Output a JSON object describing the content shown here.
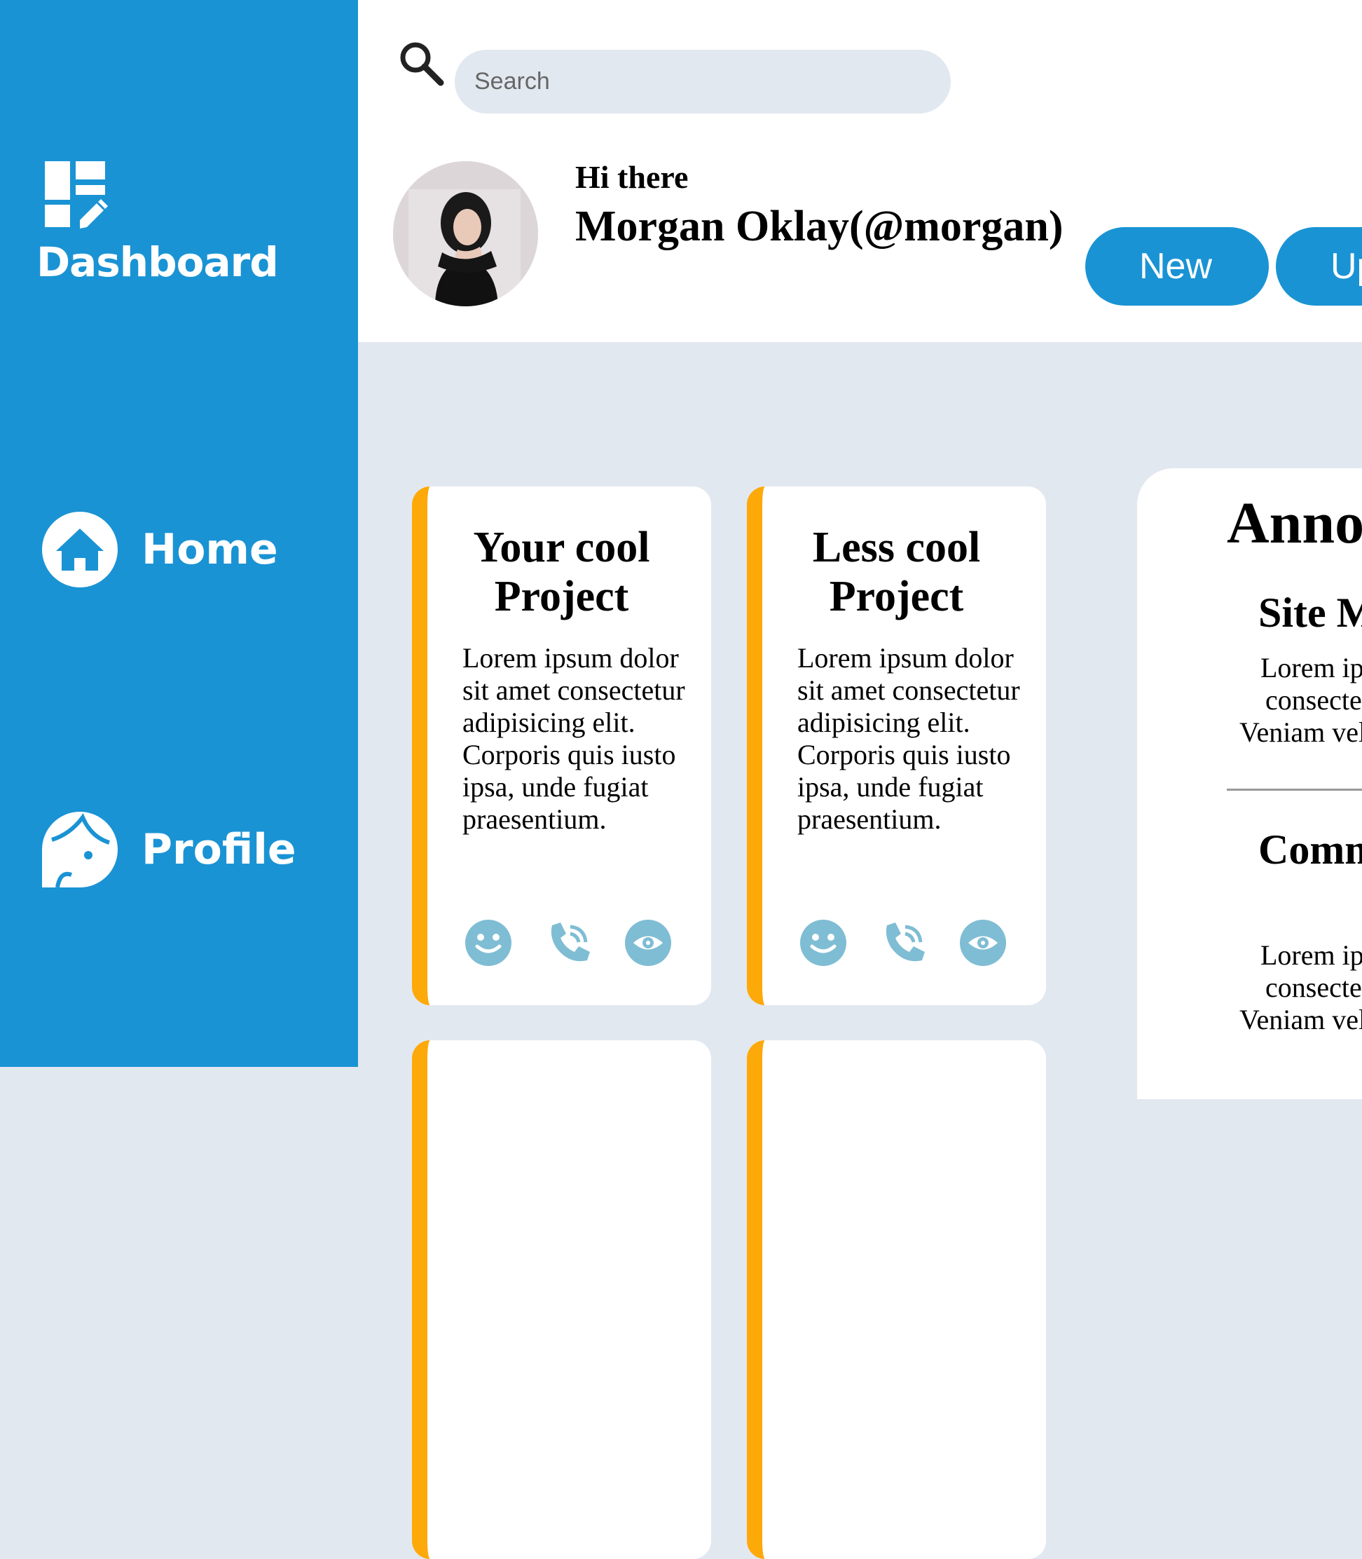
{
  "sidebar": {
    "brand": {
      "label": "Dashboard",
      "icon": "dashboard-edit-icon"
    },
    "items": [
      {
        "label": "Home",
        "icon": "home-icon"
      },
      {
        "label": "Profile",
        "icon": "profile-face-icon"
      }
    ],
    "color": "#1a93d4"
  },
  "header": {
    "search": {
      "placeholder": "Search",
      "value": ""
    },
    "greeting": "Hi there",
    "user_name": "Morgan Oklay(@morgan)",
    "buttons": {
      "new_label": "New",
      "upload_label": "Upload"
    }
  },
  "projects": [
    {
      "title": "Your cool Project",
      "body": "Lorem ipsum dolor sit amet consectetur adipisicing elit. Corporis quis iusto ipsa, unde fugiat praesentium.",
      "actions": [
        "smile-icon",
        "phone-icon",
        "eye-icon"
      ]
    },
    {
      "title": "Less cool Project",
      "body": "Lorem ipsum dolor sit amet consectetur adipisicing elit. Corporis quis iusto ipsa, unde fugiat praesentium.",
      "actions": [
        "smile-icon",
        "phone-icon",
        "eye-icon"
      ]
    }
  ],
  "announcements": {
    "title": "Announcements",
    "items": [
      {
        "title": "Site Maintenance",
        "lines": [
          "Lorem ipsum dolor sit amet",
          "consectetur adipisicing elit.",
          "Veniam velit placeat"
        ]
      },
      {
        "title": "Community Share Day",
        "lines": [
          "Lorem ipsum dolor sit amet",
          "consectetur adipisicing elit.",
          "Veniam velit placeat"
        ]
      }
    ]
  },
  "colors": {
    "accent": "#1a93d4",
    "card_border": "#fda909",
    "icon": "#7fbdd4",
    "background": "#e2e8f0"
  }
}
